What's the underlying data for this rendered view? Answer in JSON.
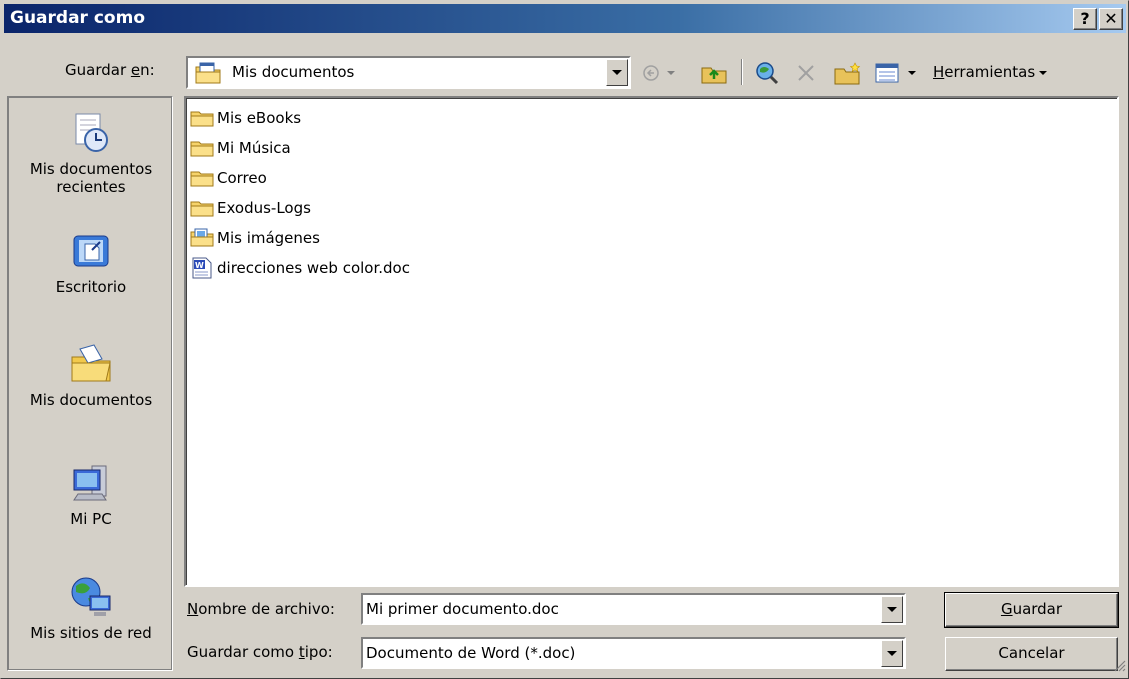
{
  "window": {
    "title": "Guardar como",
    "help_label": "?",
    "close_label": "✕"
  },
  "save_in": {
    "label_pre": "Guardar ",
    "label_u": "e",
    "label_post": "n:",
    "value": "Mis documentos"
  },
  "toolbar": {
    "tools_u": "H",
    "tools_rest": "erramientas",
    "icons": [
      "back-icon",
      "up-folder-icon",
      "search-web-icon",
      "delete-icon",
      "new-folder-icon",
      "views-icon"
    ]
  },
  "places": [
    {
      "label": "Mis documentos recientes",
      "icon": "recent-documents-icon"
    },
    {
      "label": "Escritorio",
      "icon": "desktop-icon"
    },
    {
      "label": "Mis documentos",
      "icon": "my-documents-icon"
    },
    {
      "label": "Mi PC",
      "icon": "my-computer-icon"
    },
    {
      "label": "Mis sitios de red",
      "icon": "network-places-icon"
    }
  ],
  "files": [
    {
      "name": "Mis eBooks",
      "icon": "folder-icon"
    },
    {
      "name": "Mi Música",
      "icon": "folder-icon"
    },
    {
      "name": "Correo",
      "icon": "folder-icon"
    },
    {
      "name": "Exodus-Logs",
      "icon": "folder-icon"
    },
    {
      "name": "Mis imágenes",
      "icon": "pictures-folder-icon"
    },
    {
      "name": "direcciones web color.doc",
      "icon": "word-document-icon"
    }
  ],
  "filename": {
    "label_u": "N",
    "label_rest": "ombre de archivo:",
    "value": "Mi primer documento.doc"
  },
  "filetype": {
    "label_pre": "Guardar como ",
    "label_u": "t",
    "label_post": "ipo:",
    "value": "Documento de Word (*.doc)"
  },
  "buttons": {
    "save_u": "G",
    "save_rest": "uardar",
    "cancel": "Cancelar"
  }
}
